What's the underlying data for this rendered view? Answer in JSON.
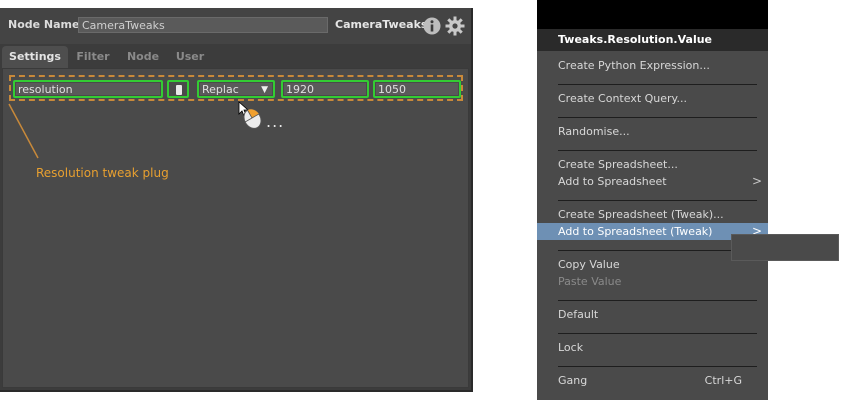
{
  "node_editor": {
    "node_name_label": "Node Name",
    "node_name_value": "CameraTweaks",
    "node_type": "CameraTweaks",
    "tabs": [
      {
        "label": "Settings",
        "active": true
      },
      {
        "label": "Filter",
        "active": false
      },
      {
        "label": "Node",
        "active": false
      },
      {
        "label": "User",
        "active": false
      }
    ],
    "tweak": {
      "name": "resolution",
      "enabled": true,
      "mode": "Replace",
      "mode_visible": "Replac",
      "width": "1920",
      "height": "1050"
    },
    "ellipsis": "...",
    "annotation": "Resolution tweak plug",
    "colors": {
      "highlight_outline": "#33cc33",
      "annotation": "#e8a030",
      "dashed_outline": "#c8893a"
    }
  },
  "context_menu": {
    "title": "Tweaks.Resolution.Value",
    "items": {
      "python_expr": "Create Python Expression...",
      "context_query": "Create Context Query...",
      "randomise": "Randomise...",
      "create_spreadsheet": "Create Spreadsheet...",
      "add_spreadsheet": "Add to Spreadsheet",
      "create_spreadsheet_tweak": "Create Spreadsheet (Tweak)...",
      "add_spreadsheet_tweak": "Add to Spreadsheet (Tweak)",
      "copy_value": "Copy Value",
      "paste_value": "Paste Value",
      "default": "Default",
      "lock": "Lock",
      "gang": "Gang",
      "gang_shortcut": "Ctrl+G"
    },
    "highlight_color": "#6e90b4"
  }
}
